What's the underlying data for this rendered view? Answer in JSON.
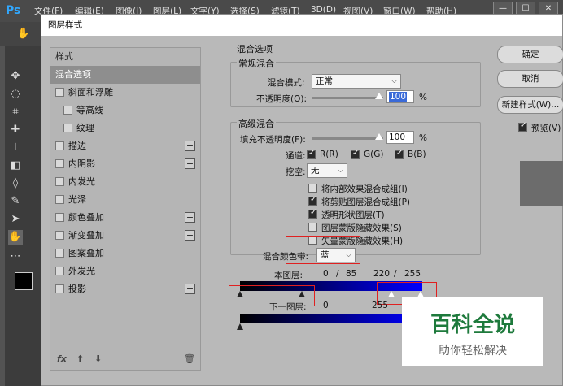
{
  "app": {
    "logo": "Ps",
    "menu": [
      "文件(F)",
      "编辑(E)",
      "图像(I)",
      "图层(L)",
      "文字(Y)",
      "选择(S)",
      "滤镜(T)",
      "3D(D)",
      "视图(V)",
      "窗口(W)",
      "帮助(H)"
    ],
    "window_buttons": [
      "—",
      "☐",
      "✕"
    ]
  },
  "dialog": {
    "title": "图层样式",
    "styles": {
      "header": "样式",
      "selected": "混合选项",
      "items": [
        {
          "label": "斜面和浮雕",
          "checked": false,
          "plus": false
        },
        {
          "label": "等高线",
          "checked": false,
          "plus": false
        },
        {
          "label": "纹理",
          "checked": false,
          "plus": false
        },
        {
          "label": "描边",
          "checked": false,
          "plus": true
        },
        {
          "label": "内阴影",
          "checked": false,
          "plus": true
        },
        {
          "label": "内发光",
          "checked": false,
          "plus": false
        },
        {
          "label": "光泽",
          "checked": false,
          "plus": false
        },
        {
          "label": "颜色叠加",
          "checked": false,
          "plus": true
        },
        {
          "label": "渐变叠加",
          "checked": false,
          "plus": true
        },
        {
          "label": "图案叠加",
          "checked": false,
          "plus": false
        },
        {
          "label": "外发光",
          "checked": false,
          "plus": false
        },
        {
          "label": "投影",
          "checked": false,
          "plus": true
        }
      ],
      "footer": {
        "fx": "fx",
        "up": "⬆",
        "down": "⬇",
        "trash": "🗑"
      }
    },
    "blending": {
      "title": "混合选项",
      "general": {
        "title": "常规混合",
        "mode_label": "混合模式:",
        "mode_value": "正常",
        "opacity_label": "不透明度(O):",
        "opacity_value": "100",
        "percent": "%"
      },
      "advanced": {
        "title": "高级混合",
        "fill_label": "填充不透明度(F):",
        "fill_value": "100",
        "percent": "%",
        "channels_label": "通道:",
        "channels": [
          {
            "label": "R(R)",
            "checked": true
          },
          {
            "label": "G(G)",
            "checked": true
          },
          {
            "label": "B(B)",
            "checked": true
          }
        ],
        "knockout_label": "挖空:",
        "knockout_value": "无",
        "options": [
          {
            "label": "将内部效果混合成组(I)",
            "checked": false
          },
          {
            "label": "将剪贴图层混合成组(P)",
            "checked": true
          },
          {
            "label": "透明形状图层(T)",
            "checked": true
          },
          {
            "label": "图层蒙版隐藏效果(S)",
            "checked": false
          },
          {
            "label": "矢量蒙版隐藏效果(H)",
            "checked": false
          }
        ]
      },
      "blend_if": {
        "label": "混合颜色带:",
        "value": "蓝",
        "this_layer_label": "本图层:",
        "this_layer_values": [
          "0",
          "/",
          "85",
          "220",
          "/",
          "255"
        ],
        "underlying_label": "下一图层:",
        "underlying_values": [
          "0",
          "255"
        ]
      }
    },
    "buttons": {
      "ok": "确定",
      "cancel": "取消",
      "new_style": "新建样式(W)...",
      "preview_label": "预览(V)",
      "preview_checked": true
    }
  },
  "watermark": {
    "title": "百科全说",
    "subtitle": "助你轻松解决"
  },
  "colors": {
    "blue_band": "#0000ff",
    "highlight_red": "#e02020",
    "watermark_green": "#1e7a3c"
  }
}
